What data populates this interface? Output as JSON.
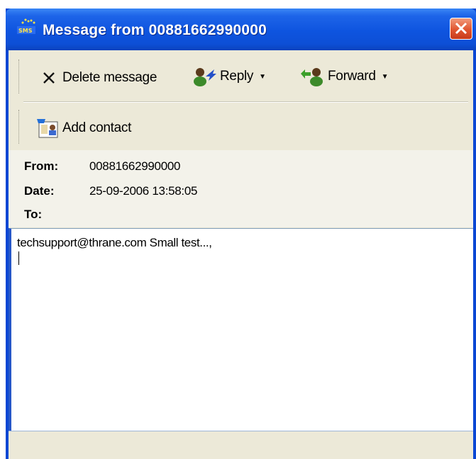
{
  "window": {
    "title": "Message from 00881662990000",
    "app_icon": "sms-icon"
  },
  "toolbar": {
    "delete_label": "Delete message",
    "reply_label": "Reply",
    "forward_label": "Forward",
    "add_contact_label": "Add contact"
  },
  "header": {
    "from_label": "From:",
    "from_value": "00881662990000",
    "date_label": "Date:",
    "date_value": "25-09-2006 13:58:05",
    "to_label": "To:",
    "to_value": ""
  },
  "message": {
    "body": "techsupport@thrane.com Small test...,"
  },
  "colors": {
    "titlebar": "#0d4fd6",
    "window_bg": "#ece9d8",
    "close_button": "#e0552f"
  }
}
